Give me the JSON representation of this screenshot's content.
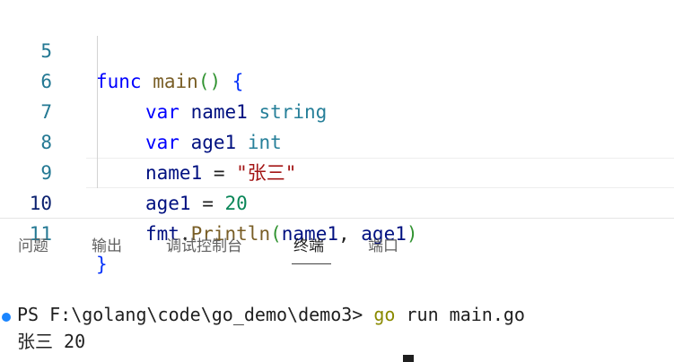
{
  "editor": {
    "lines": [
      {
        "num": "5",
        "parts": [
          "func",
          " ",
          "main",
          "()",
          " ",
          "{"
        ]
      },
      {
        "num": "6",
        "parts": [
          "var",
          " ",
          "name1",
          " ",
          "string"
        ]
      },
      {
        "num": "7",
        "parts": [
          "var",
          " ",
          "age1",
          " ",
          "int"
        ]
      },
      {
        "num": "8",
        "parts": [
          "name1",
          " = ",
          "\"张三\""
        ]
      },
      {
        "num": "9",
        "parts": [
          "age1",
          " = ",
          "20"
        ]
      },
      {
        "num": "10",
        "parts": [
          "fmt",
          ".",
          "Println",
          "(",
          "name1",
          ", ",
          "age1",
          ")"
        ]
      },
      {
        "num": "11",
        "parts": [
          "}"
        ]
      }
    ]
  },
  "panel": {
    "tabs": [
      "问题",
      "输出",
      "调试控制台",
      "终端",
      "端口"
    ],
    "active_tab": "终端"
  },
  "terminal": {
    "prompt": "PS F:\\golang\\code\\go_demo\\demo3> ",
    "command_go": "go",
    "command_rest": " run main.go",
    "output": "张三 20"
  }
}
